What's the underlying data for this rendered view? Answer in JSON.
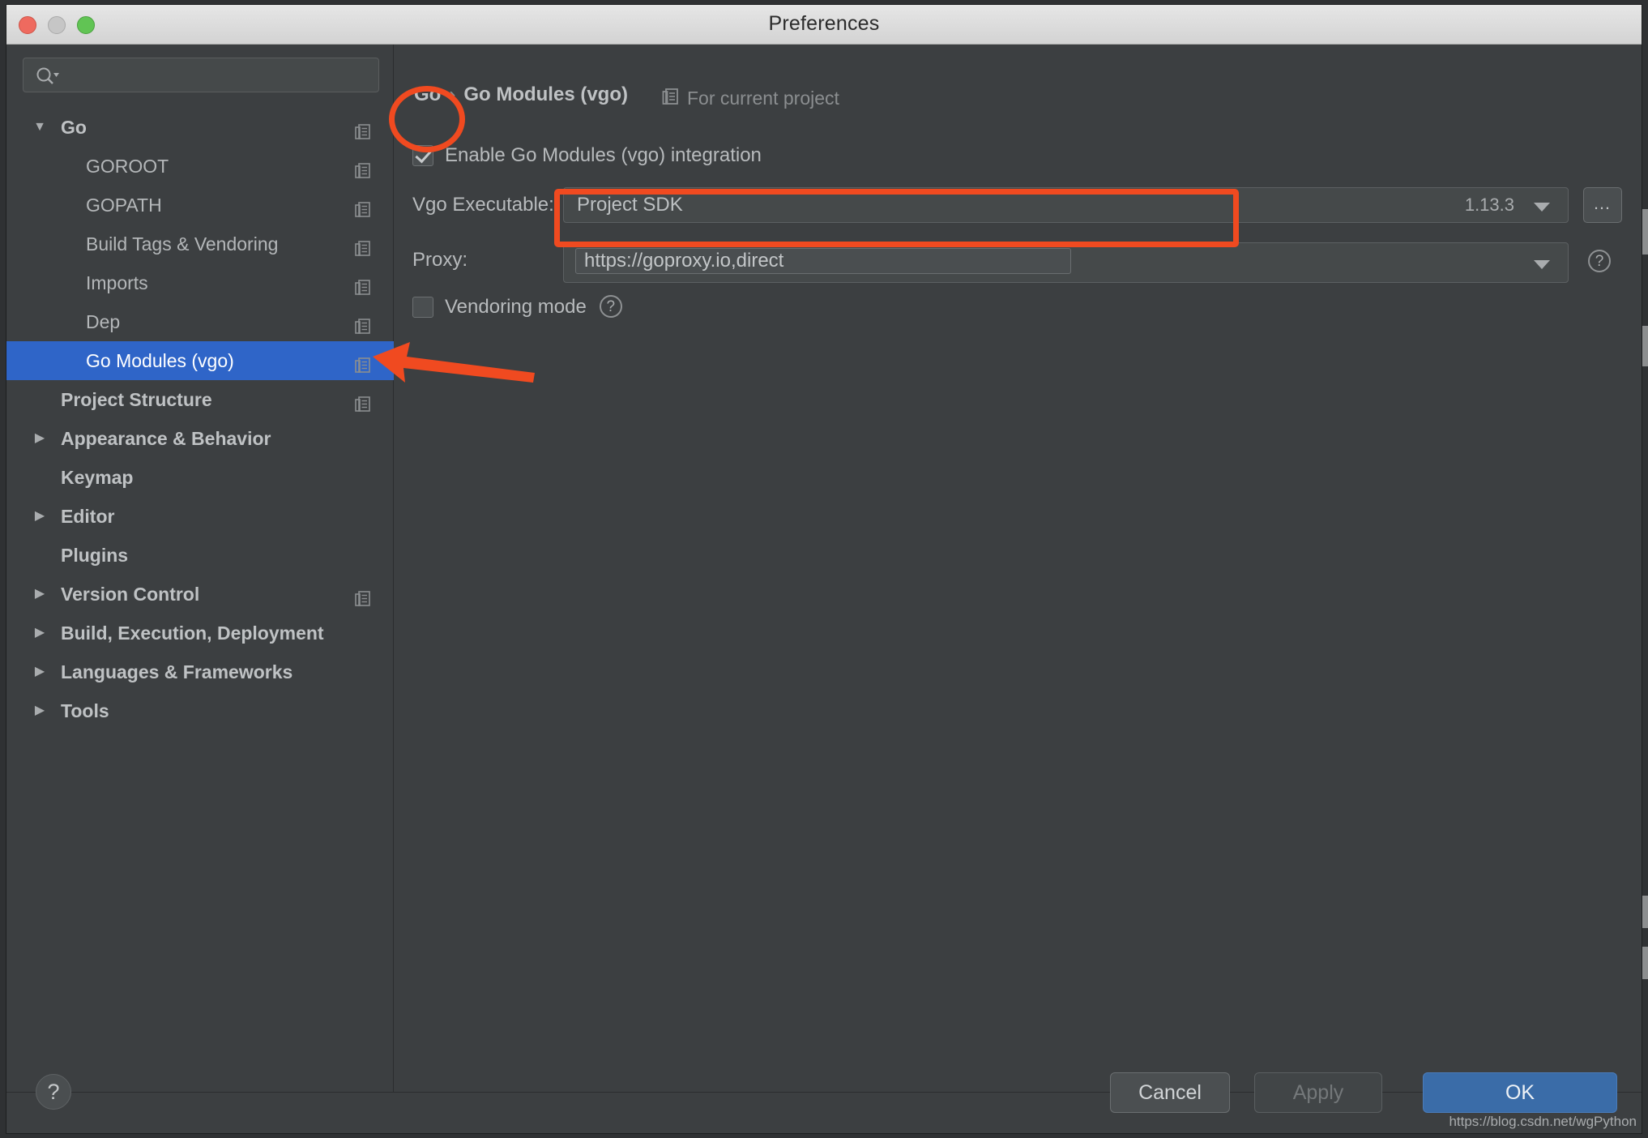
{
  "window": {
    "title": "Preferences",
    "traffic_lights": [
      "close",
      "minimize",
      "maximize"
    ]
  },
  "search": {
    "placeholder": "",
    "value": "",
    "icon": "search-icon"
  },
  "sidebar": {
    "items": [
      {
        "label": "Go",
        "depth": 0,
        "twisty": "▼",
        "selected": false,
        "badge": true
      },
      {
        "label": "GOROOT",
        "depth": 1,
        "twisty": "",
        "selected": false,
        "badge": true
      },
      {
        "label": "GOPATH",
        "depth": 1,
        "twisty": "",
        "selected": false,
        "badge": true
      },
      {
        "label": "Build Tags & Vendoring",
        "depth": 1,
        "twisty": "",
        "selected": false,
        "badge": true
      },
      {
        "label": "Imports",
        "depth": 1,
        "twisty": "",
        "selected": false,
        "badge": true
      },
      {
        "label": "Dep",
        "depth": 1,
        "twisty": "",
        "selected": false,
        "badge": true
      },
      {
        "label": "Go Modules (vgo)",
        "depth": 1,
        "twisty": "",
        "selected": true,
        "badge": true
      },
      {
        "label": "Project Structure",
        "depth": 0,
        "twisty": "",
        "selected": false,
        "badge": true
      },
      {
        "label": "Appearance & Behavior",
        "depth": 0,
        "twisty": "▶",
        "selected": false,
        "badge": false
      },
      {
        "label": "Keymap",
        "depth": 0,
        "twisty": "",
        "selected": false,
        "badge": false
      },
      {
        "label": "Editor",
        "depth": 0,
        "twisty": "▶",
        "selected": false,
        "badge": false
      },
      {
        "label": "Plugins",
        "depth": 0,
        "twisty": "",
        "selected": false,
        "badge": false
      },
      {
        "label": "Version Control",
        "depth": 0,
        "twisty": "▶",
        "selected": false,
        "badge": true
      },
      {
        "label": "Build, Execution, Deployment",
        "depth": 0,
        "twisty": "▶",
        "selected": false,
        "badge": false
      },
      {
        "label": "Languages & Frameworks",
        "depth": 0,
        "twisty": "▶",
        "selected": false,
        "badge": false
      },
      {
        "label": "Tools",
        "depth": 0,
        "twisty": "▶",
        "selected": false,
        "badge": false
      }
    ]
  },
  "main": {
    "breadcrumb_root": "Go",
    "breadcrumb_sep": "›",
    "breadcrumb_leaf": "Go Modules (vgo)",
    "scope_label": "For current project",
    "enable_checkbox": {
      "label": "Enable Go Modules (vgo) integration",
      "checked": true
    },
    "vgo_executable": {
      "label": "Vgo Executable:",
      "value": "Project SDK",
      "version": "1.13.3",
      "browse_label": "…"
    },
    "proxy": {
      "label": "Proxy:",
      "value": "https://goproxy.io,direct",
      "help_glyph": "?"
    },
    "vendoring": {
      "label": "Vendoring mode",
      "checked": false,
      "help_glyph": "?"
    }
  },
  "footer": {
    "help_glyph": "?",
    "cancel_label": "Cancel",
    "apply_label": "Apply",
    "ok_label": "OK"
  },
  "annotations": {
    "ellipse_target": "enable-checkbox",
    "rect_target": "proxy-field",
    "arrow_target": "sidebar-item-go-modules-vgo",
    "accent_color": "#f04a20",
    "selection_color": "#2f65c8"
  },
  "watermark": {
    "text": "https://blog.csdn.net/wgPython"
  }
}
